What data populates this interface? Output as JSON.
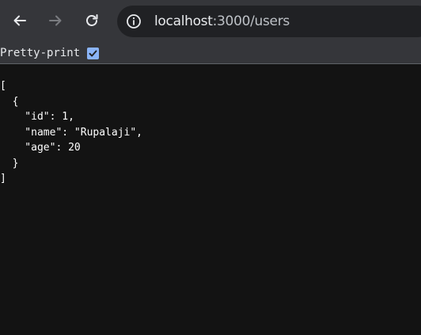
{
  "browser": {
    "url_host": "localhost",
    "url_path": ":3000/users",
    "icons": {
      "back": "back-arrow-icon",
      "forward": "forward-arrow-icon",
      "reload": "reload-icon",
      "site_info": "info-icon"
    }
  },
  "viewer": {
    "pretty_print_label": "Pretty-print",
    "pretty_print_checked": true,
    "json_lines": [
      "[",
      "  {",
      "    \"id\": 1,",
      "    \"name\": \"Rupalaji\",",
      "    \"age\": 20",
      "  }",
      "]"
    ]
  },
  "colors": {
    "toolbar": "#35363a",
    "omnibox": "#202124",
    "page_background": "#131313",
    "checkbox": "#8ab4f8"
  }
}
